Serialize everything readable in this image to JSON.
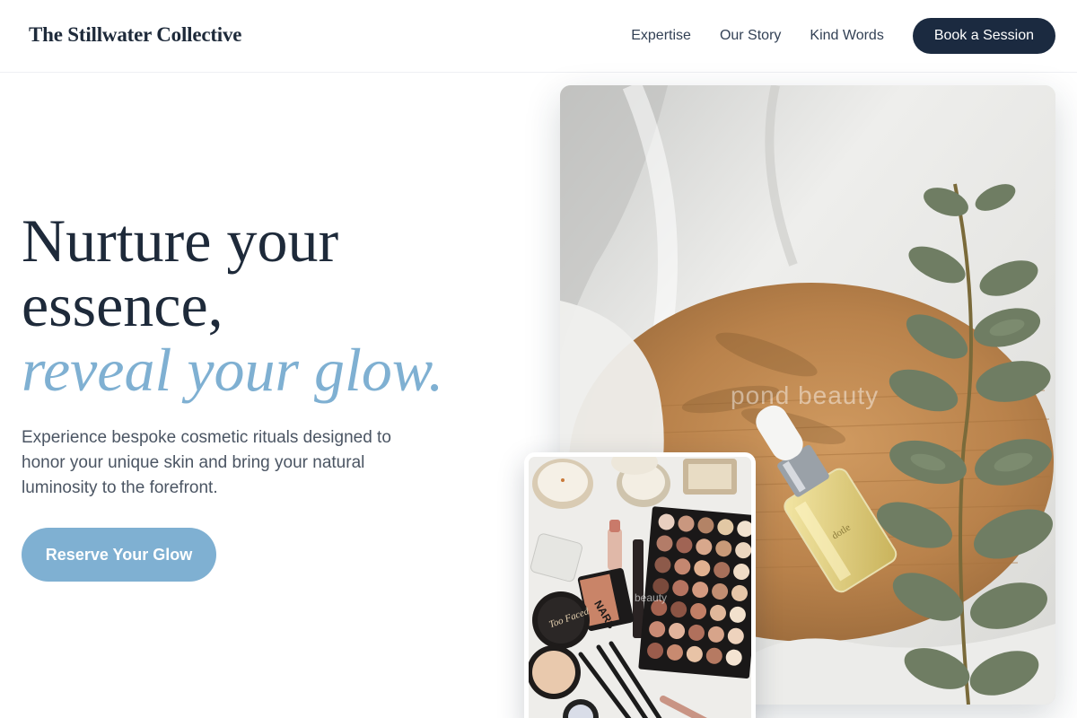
{
  "header": {
    "brand": "The Stillwater Collective",
    "nav": [
      "Expertise",
      "Our Story",
      "Kind Words"
    ],
    "cta": "Book a Session"
  },
  "hero": {
    "title_line1": "Nurture your",
    "title_line2": "essence,",
    "title_accent": "reveal your glow.",
    "subtitle": "Experience bespoke cosmetic rituals designed to honor your unique skin and bring your natural luminosity to the forefront.",
    "cta": "Reserve Your Glow"
  },
  "images": {
    "main_watermark": "pond beauty",
    "small_watermark": "beauty"
  },
  "colors": {
    "navy": "#1b2a40",
    "accent_blue": "#7fb0d2",
    "text_gray": "#4b5563"
  }
}
